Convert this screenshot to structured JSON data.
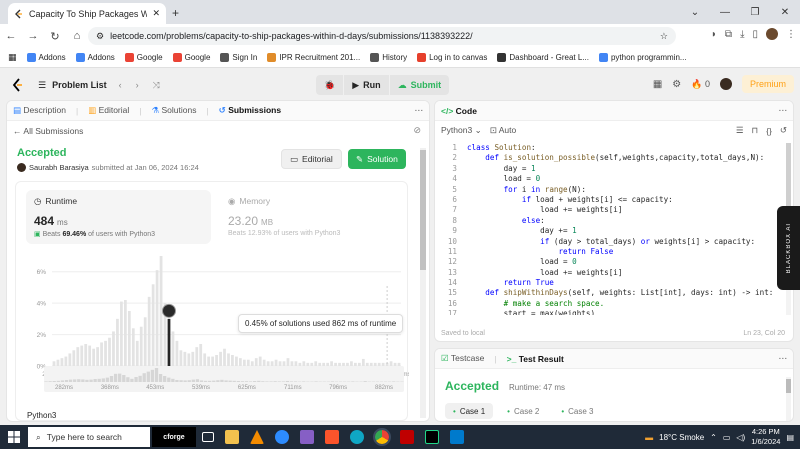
{
  "browser": {
    "tab_title": "Capacity To Ship Packages Wit",
    "url": "leetcode.com/problems/capacity-to-ship-packages-within-d-days/submissions/1138393222/",
    "bookmarks": [
      "Addons",
      "Addons",
      "Google",
      "Google",
      "Sign In",
      "IPR Recruitment 201...",
      "History",
      "Log in to canvas",
      "Dashboard - Great L...",
      "python programmin..."
    ]
  },
  "nav": {
    "problem_list": "Problem List",
    "run": "Run",
    "submit": "Submit",
    "streak": "0",
    "premium": "Premium"
  },
  "left": {
    "tabs": [
      "Description",
      "Editorial",
      "Solutions",
      "Submissions"
    ],
    "all_submissions": "All Submissions",
    "status": "Accepted",
    "author": "Saurabh Barasiya",
    "submitted_text": "submitted at Jan 06, 2024 16:24",
    "editorial_btn": "Editorial",
    "solution_btn": "Solution",
    "runtime_label": "Runtime",
    "runtime_value": "484",
    "runtime_unit": "ms",
    "runtime_beats_prefix": "Beats",
    "runtime_beats_pct": "69.46%",
    "runtime_beats_suffix": "of users with Python3",
    "memory_label": "Memory",
    "memory_value": "23.20",
    "memory_unit": "MB",
    "memory_beats": "Beats 12.93% of users with Python3",
    "tooltip": "0.45% of solutions used 862 ms of runtime",
    "lang_footer": "Python3"
  },
  "chart_data": {
    "type": "bar",
    "yticks": [
      "6%",
      "4%",
      "2%",
      "0%"
    ],
    "ylim": [
      0,
      7
    ],
    "xticks": [
      "282ms",
      "368ms",
      "453ms",
      "539ms",
      "625ms",
      "711ms",
      "796ms",
      "882ms"
    ],
    "xlim": [
      282,
      882
    ],
    "highlight_ms": 484,
    "values": [
      0.3,
      0.4,
      0.5,
      0.6,
      0.8,
      1.0,
      1.2,
      1.3,
      1.4,
      1.3,
      1.1,
      1.2,
      1.5,
      1.6,
      1.8,
      2.2,
      3.0,
      4.1,
      4.2,
      3.5,
      2.4,
      1.6,
      2.5,
      3.1,
      4.4,
      5.2,
      6.1,
      7.0,
      4.0,
      3.0,
      2.2,
      1.6,
      1.0,
      0.9,
      0.8,
      0.9,
      1.2,
      1.4,
      0.8,
      0.6,
      0.6,
      0.7,
      0.9,
      1.1,
      0.8,
      0.7,
      0.6,
      0.5,
      0.4,
      0.4,
      0.3,
      0.5,
      0.6,
      0.4,
      0.3,
      0.3,
      0.4,
      0.3,
      0.3,
      0.5,
      0.3,
      0.3,
      0.2,
      0.3,
      0.2,
      0.2,
      0.3,
      0.2,
      0.2,
      0.2,
      0.3,
      0.2,
      0.2,
      0.2,
      0.2,
      0.3,
      0.2,
      0.2,
      0.45,
      0.2,
      0.2,
      0.2,
      0.2,
      0.2,
      0.2,
      0.3,
      0.2,
      0.2
    ]
  },
  "code": {
    "header": "Code",
    "lang": "Python3",
    "auto": "Auto",
    "saved": "Saved to local",
    "position": "Ln 23, Col 20",
    "lines": [
      {
        "n": "1",
        "t": [
          [
            "kw",
            "class "
          ],
          [
            "fn",
            "Solution"
          ],
          [
            "",
            ":"
          ]
        ]
      },
      {
        "n": "2",
        "t": [
          [
            "",
            "    "
          ],
          [
            "kw",
            "def "
          ],
          [
            "fn",
            "is_solution_possible"
          ],
          [
            "",
            "(self,weights,capacity,total_days,N):"
          ]
        ]
      },
      {
        "n": "3",
        "t": [
          [
            "",
            "        day = "
          ],
          [
            "nm",
            "1"
          ]
        ]
      },
      {
        "n": "4",
        "t": [
          [
            "",
            "        load = "
          ],
          [
            "nm",
            "0"
          ]
        ]
      },
      {
        "n": "5",
        "t": [
          [
            "",
            "        "
          ],
          [
            "kw",
            "for "
          ],
          [
            "",
            "i "
          ],
          [
            "kw",
            "in "
          ],
          [
            "fn",
            "range"
          ],
          [
            "",
            "(N):"
          ]
        ]
      },
      {
        "n": "6",
        "t": [
          [
            "",
            "            "
          ],
          [
            "kw",
            "if "
          ],
          [
            "",
            "load + weights[i] <= capacity:"
          ]
        ]
      },
      {
        "n": "7",
        "t": [
          [
            "",
            "                load += weights[i]"
          ]
        ]
      },
      {
        "n": "8",
        "t": [
          [
            "",
            "            "
          ],
          [
            "kw",
            "else"
          ],
          [
            "",
            ":"
          ]
        ]
      },
      {
        "n": "9",
        "t": [
          [
            "",
            "                day += "
          ],
          [
            "nm",
            "1"
          ]
        ]
      },
      {
        "n": "10",
        "t": [
          [
            "",
            "                "
          ],
          [
            "kw",
            "if "
          ],
          [
            "",
            "(day > total_days) "
          ],
          [
            "kw",
            "or "
          ],
          [
            "",
            "weights[i] > capacity:"
          ]
        ]
      },
      {
        "n": "11",
        "t": [
          [
            "",
            "                    "
          ],
          [
            "kw",
            "return "
          ],
          [
            "kw",
            "False"
          ]
        ]
      },
      {
        "n": "12",
        "t": [
          [
            "",
            "                load = "
          ],
          [
            "nm",
            "0"
          ]
        ]
      },
      {
        "n": "13",
        "t": [
          [
            "",
            "                load += weights[i]"
          ]
        ]
      },
      {
        "n": "14",
        "t": [
          [
            "",
            "        "
          ],
          [
            "kw",
            "return "
          ],
          [
            "kw",
            "True"
          ]
        ]
      },
      {
        "n": "15",
        "t": [
          [
            "",
            "    "
          ],
          [
            "kw",
            "def "
          ],
          [
            "fn",
            "shipWithinDays"
          ],
          [
            "",
            "(self, weights: List[int], days: int) -> int:"
          ]
        ]
      },
      {
        "n": "16",
        "t": [
          [
            "",
            "        "
          ],
          [
            "cm",
            "# make a search space."
          ]
        ]
      },
      {
        "n": "17",
        "t": [
          [
            "",
            "        start = max(weights)"
          ]
        ]
      }
    ]
  },
  "bottom": {
    "testcase": "Testcase",
    "test_result": "Test Result",
    "status": "Accepted",
    "runtime": "Runtime: 47 ms",
    "cases": [
      "Case 1",
      "Case 2",
      "Case 3"
    ]
  },
  "taskbar": {
    "search": "Type here to search",
    "weather": "18°C  Smoke",
    "time": "4:26 PM",
    "date": "1/6/2024"
  },
  "blackbox": "BLACKBOX AI"
}
